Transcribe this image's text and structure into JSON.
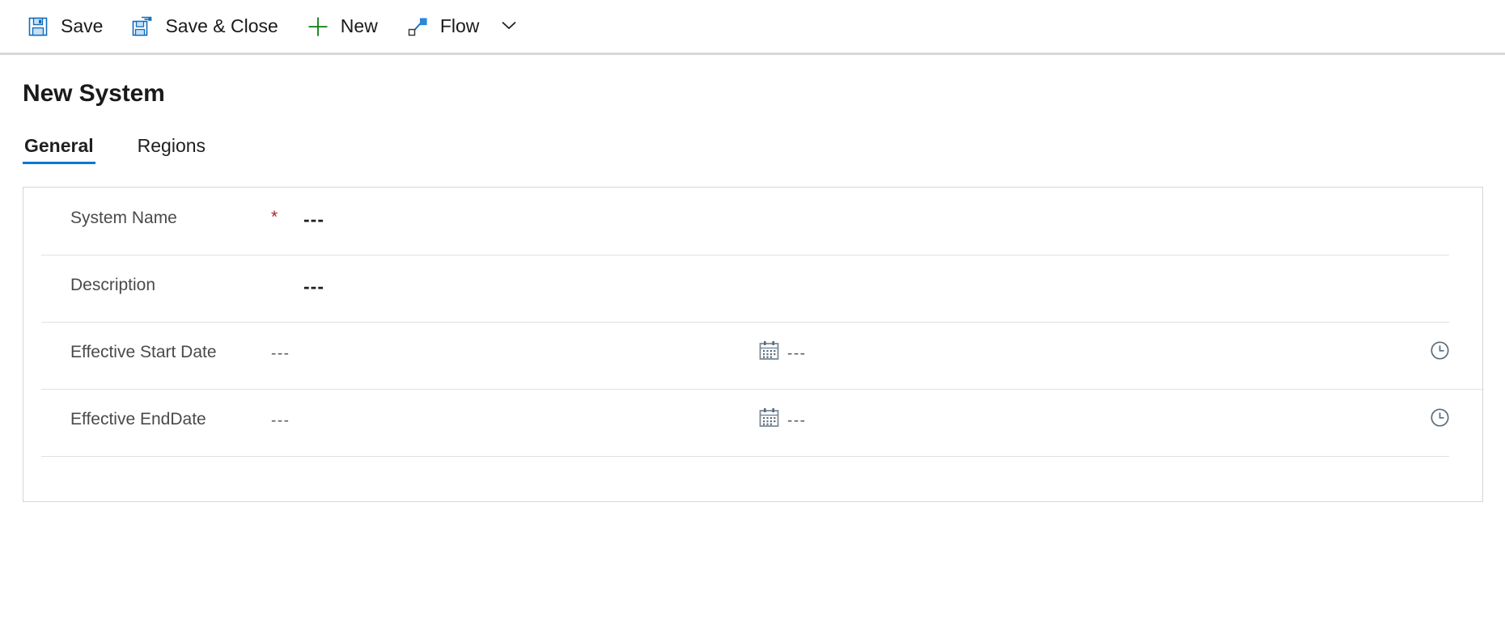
{
  "command_bar": {
    "buttons": [
      {
        "id": "save",
        "label": "Save",
        "icon": "save-icon"
      },
      {
        "id": "save-close",
        "label": "Save & Close",
        "icon": "save-and-close-icon"
      },
      {
        "id": "new",
        "label": "New",
        "icon": "plus-icon"
      },
      {
        "id": "flow",
        "label": "Flow",
        "icon": "flow-icon"
      }
    ],
    "overflow_icon": "chevron-down-icon"
  },
  "header": {
    "title": "New System"
  },
  "tabs": [
    {
      "id": "general",
      "label": "General",
      "active": true
    },
    {
      "id": "regions",
      "label": "Regions",
      "active": false
    }
  ],
  "form": {
    "rows": [
      {
        "id": "system-name",
        "label": "System Name",
        "required": true,
        "required_marker": "*",
        "value": "---",
        "has_date_icons": false
      },
      {
        "id": "description",
        "label": "Description",
        "required": false,
        "required_marker": "",
        "value": "---",
        "has_date_icons": false
      },
      {
        "id": "effective-start-date",
        "label": "Effective Start Date",
        "required": false,
        "required_marker": "",
        "value": "---",
        "time_value": "---",
        "has_date_icons": true,
        "date_icon": "calendar-icon",
        "time_icon": "clock-icon"
      },
      {
        "id": "effective-end-date",
        "label": "Effective EndDate",
        "required": false,
        "required_marker": "",
        "value": "---",
        "time_value": "---",
        "has_date_icons": true,
        "date_icon": "calendar-icon",
        "time_icon": "clock-icon"
      }
    ]
  },
  "colors": {
    "accent": "#0078d4",
    "required": "#a4262c",
    "new_icon": "#107c10",
    "text": "#201f1e",
    "border": "#d6d6d6",
    "divider": "#e1e1e1"
  }
}
